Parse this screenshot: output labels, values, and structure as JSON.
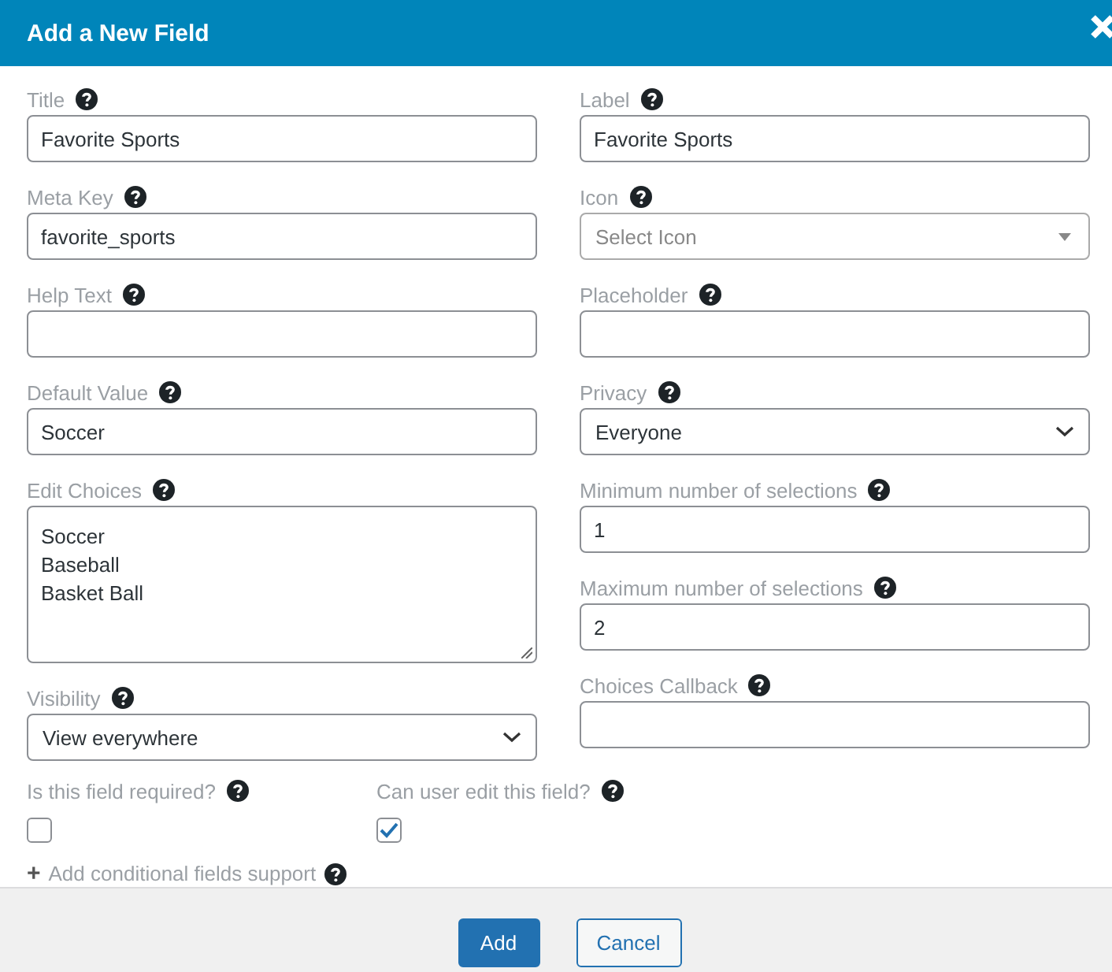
{
  "dialog": {
    "title": "Add a New Field"
  },
  "columns": [
    [
      {
        "kind": "input",
        "label": "Title",
        "value": "Favorite Sports"
      },
      {
        "kind": "input",
        "label": "Meta Key",
        "value": "favorite_sports"
      },
      {
        "kind": "input",
        "label": "Help Text"
      },
      {
        "kind": "input",
        "label": "Default Value",
        "value": "Soccer"
      },
      {
        "kind": "textarea",
        "label": "Edit Choices",
        "lines": [
          "Soccer",
          "Baseball",
          "Basket Ball"
        ]
      },
      {
        "kind": "select",
        "label": "Visibility",
        "value": "View everywhere"
      }
    ],
    [
      {
        "kind": "input",
        "label": "Label",
        "value": "Favorite Sports"
      },
      {
        "kind": "combo",
        "label": "Icon",
        "placeholder": "Select Icon"
      },
      {
        "kind": "input",
        "label": "Placeholder"
      },
      {
        "kind": "select",
        "label": "Privacy",
        "value": "Everyone"
      },
      {
        "kind": "input",
        "label": "Minimum number of selections",
        "value": "1"
      },
      {
        "kind": "input",
        "label": "Maximum number of selections",
        "value": "2"
      },
      {
        "kind": "input",
        "label": "Choices Callback"
      }
    ]
  ],
  "checkboxes": [
    {
      "label": "Is this field required?",
      "checked": false
    },
    {
      "label": "Can user edit this field?",
      "checked": true
    }
  ],
  "conditional_link": {
    "symbol": "+",
    "label": "Add conditional fields support"
  },
  "buttons": [
    {
      "label": "Add",
      "kind": "primary"
    },
    {
      "label": "Cancel",
      "kind": "secondary"
    }
  ]
}
